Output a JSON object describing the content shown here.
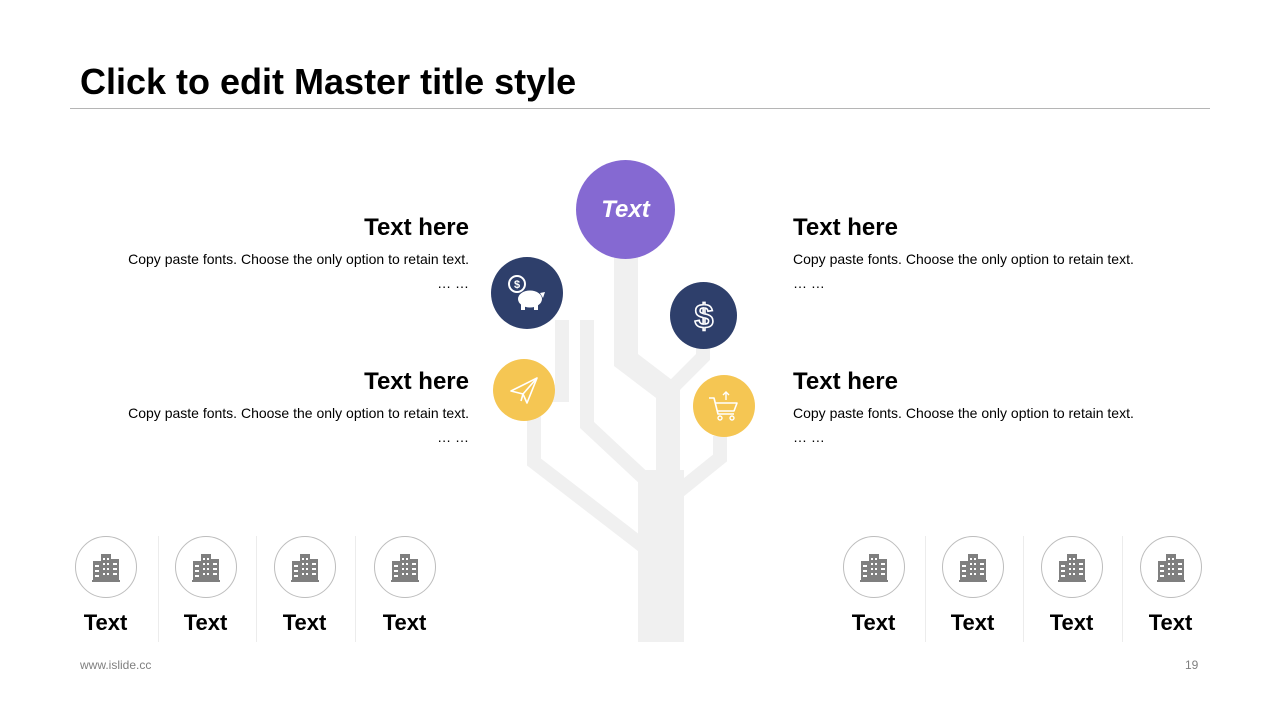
{
  "slide": {
    "title": "Click to edit Master title style",
    "center_label": "Text",
    "blocks": [
      {
        "heading": "Text here",
        "body": "Copy paste fonts. Choose the only option to retain text.",
        "more": "… …"
      },
      {
        "heading": "Text here",
        "body": "Copy paste fonts. Choose the only option to retain text.",
        "more": "… …"
      },
      {
        "heading": "Text here",
        "body": "Copy paste fonts. Choose the only option to retain text.",
        "more": "… …"
      },
      {
        "heading": "Text here",
        "body": "Copy paste fonts. Choose the only option to retain text.",
        "more": "… …"
      }
    ],
    "icons": [
      "piggy-bank-icon",
      "dollar-icon",
      "paper-plane-icon",
      "cart-icon",
      "building-icon"
    ],
    "buildings": [
      "Text",
      "Text",
      "Text",
      "Text",
      "Text",
      "Text",
      "Text",
      "Text"
    ],
    "footer_url": "www.islide.cc",
    "page_number": "19"
  },
  "colors": {
    "purple": "#8569d2",
    "navy": "#2e3f6b",
    "gold": "#f5c653",
    "tree": "#f0f0f0",
    "building": "#7f7f7f"
  }
}
